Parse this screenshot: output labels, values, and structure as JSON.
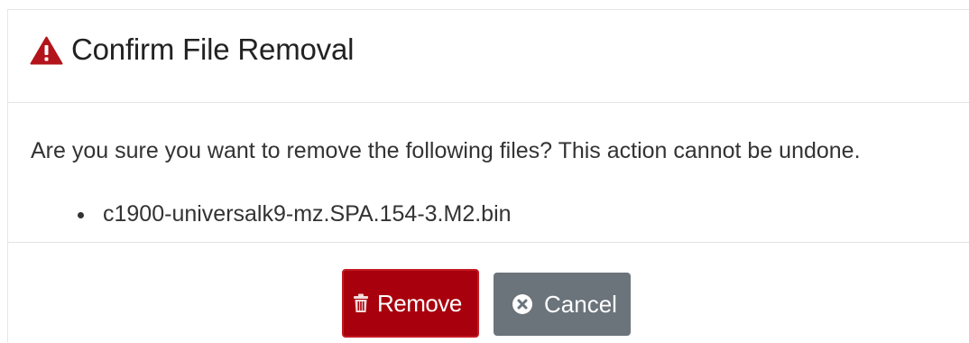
{
  "dialog": {
    "title": "Confirm File Removal",
    "title_icon": "warning-triangle-icon",
    "message": "Are you sure you want to remove the following files? This action cannot be undone.",
    "files": [
      "c1900-universalk9-mz.SPA.154-3.M2.bin"
    ],
    "buttons": {
      "remove_label": "Remove",
      "remove_icon": "trash-icon",
      "cancel_label": "Cancel",
      "cancel_icon": "close-circle-icon"
    }
  },
  "colors": {
    "warning_icon": "#b3141b",
    "remove_button": "#a8000c",
    "cancel_button": "#6b737b"
  }
}
